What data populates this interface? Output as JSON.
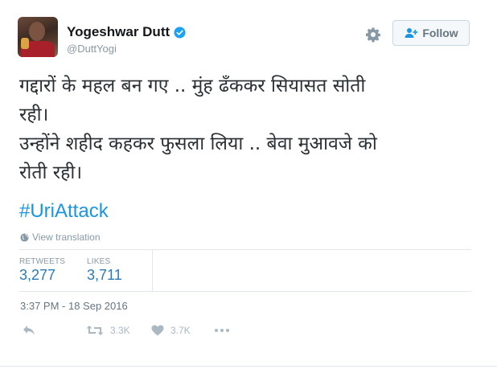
{
  "user": {
    "name": "Yogeshwar Dutt",
    "handle": "@DuttYogi",
    "avatar_icon": "profile-photo",
    "verified_icon": "verified-badge-icon"
  },
  "follow_button": {
    "label": "Follow",
    "icon": "add-person-icon"
  },
  "tweet": {
    "lines": [
      "गद्दारों के महल बन गए .. मुंह ढँककर सियासत सोती",
      "रही।",
      "उन्होंने शहीद कहकर फुसला लिया .. बेवा मुआवजे को",
      "रोती रही।"
    ],
    "hashtag": "#UriAttack",
    "translate_label": "View translation",
    "translate_icon": "globe-icon"
  },
  "stats": {
    "retweets_label": "RETWEETS",
    "retweets_value": "3,277",
    "likes_label": "LIKES",
    "likes_value": "3,711"
  },
  "timestamp": "3:37 PM - 18 Sep 2016",
  "actions": {
    "reply_icon": "reply-icon",
    "retweet_icon": "retweet-icon",
    "retweet_count": "3.3K",
    "like_icon": "heart-icon",
    "like_count": "3.7K",
    "more_icon": "more-dots-icon"
  },
  "colors": {
    "link": "#1b95e0",
    "stat_value": "#2b7bb9",
    "muted": "#8899a6",
    "verified": "#1da1f2",
    "action_icons": "#aab8c2"
  }
}
